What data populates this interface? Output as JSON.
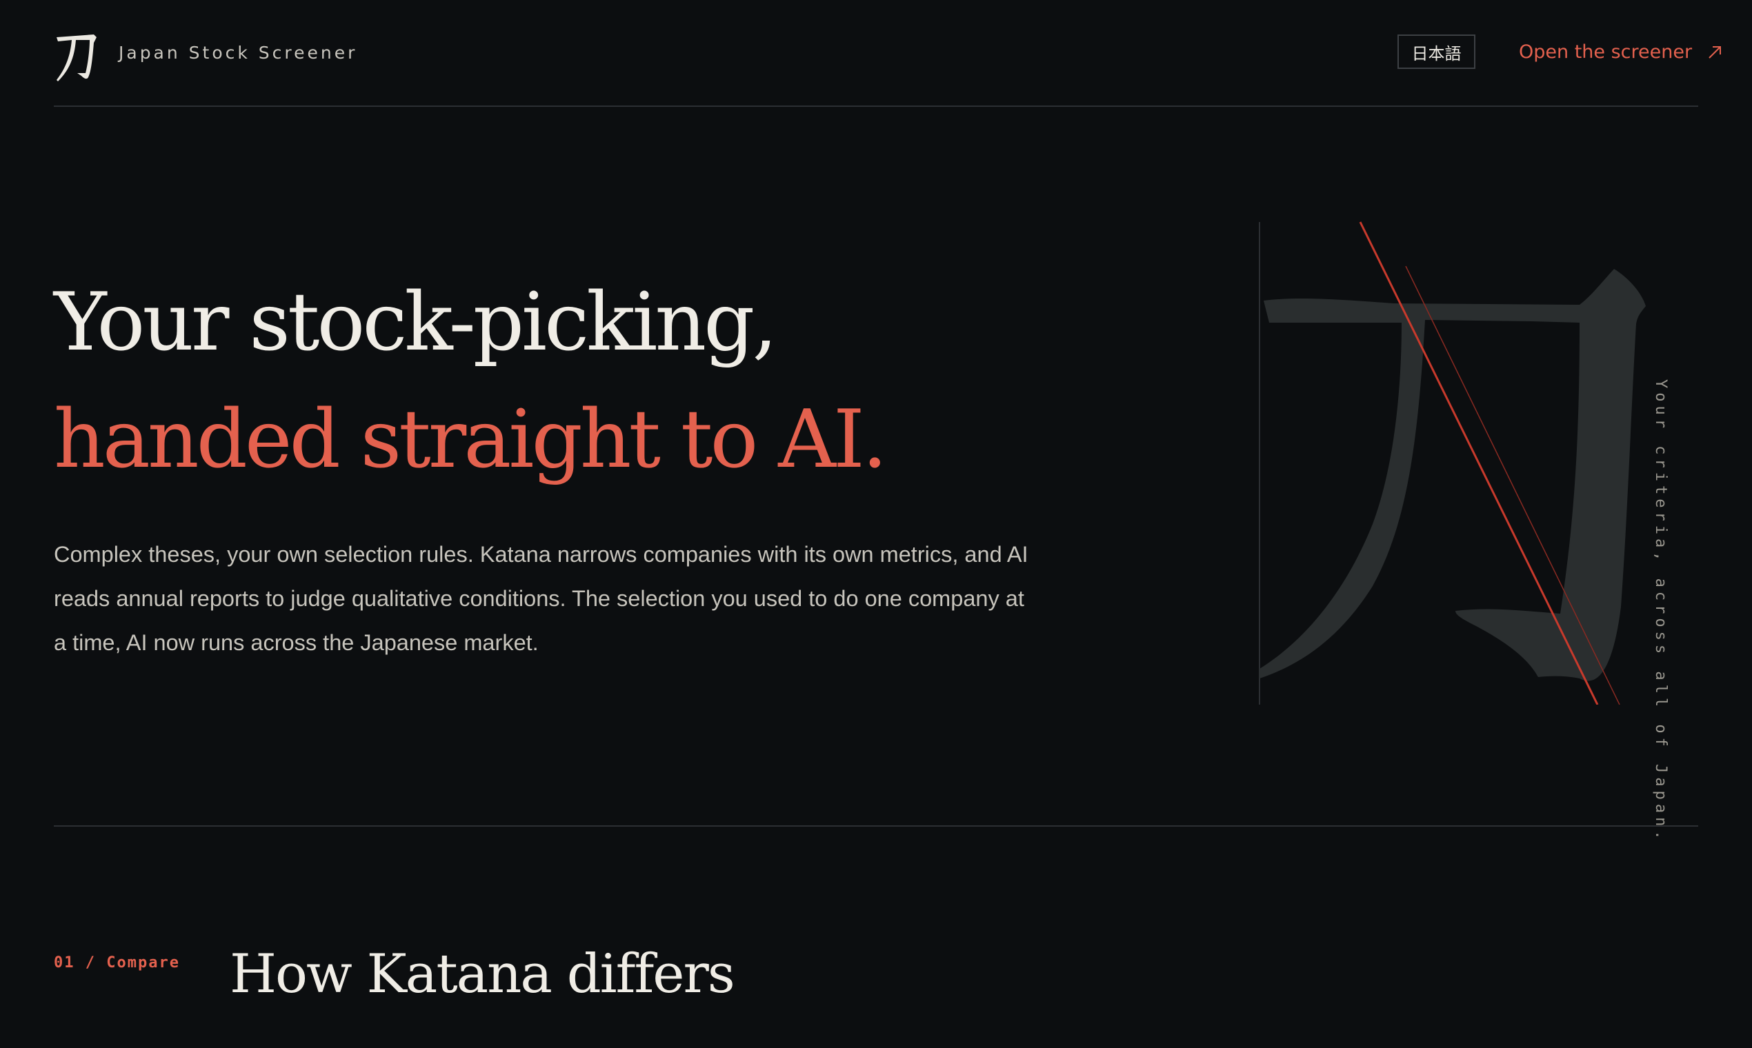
{
  "header": {
    "brand_title": "Japan Stock Screener",
    "logo_icon": "katana-kanji-logo",
    "language_label": "日本語",
    "cta_label": "Open the screener",
    "cta_icon": "arrow-up-right-icon"
  },
  "hero": {
    "headline_line1": "Your stock-picking,",
    "headline_line2": "handed straight to AI.",
    "body": "Complex theses, your own selection rules. Katana narrows companies with its own metrics, and AI reads annual reports to judge qualitative conditions. The selection you used to do one company at a time, AI now runs across the Japanese market.",
    "vertical_caption": "Your criteria, across all of Japan."
  },
  "section": {
    "label": "01 / Compare",
    "title": "How Katana differs"
  },
  "colors": {
    "background": "#0c0e10",
    "accent": "#e4614e",
    "text": "#f0ede6",
    "muted": "#c7c4bc",
    "rule": "#2c2f33",
    "art_glyph": "#2a2e2f"
  }
}
